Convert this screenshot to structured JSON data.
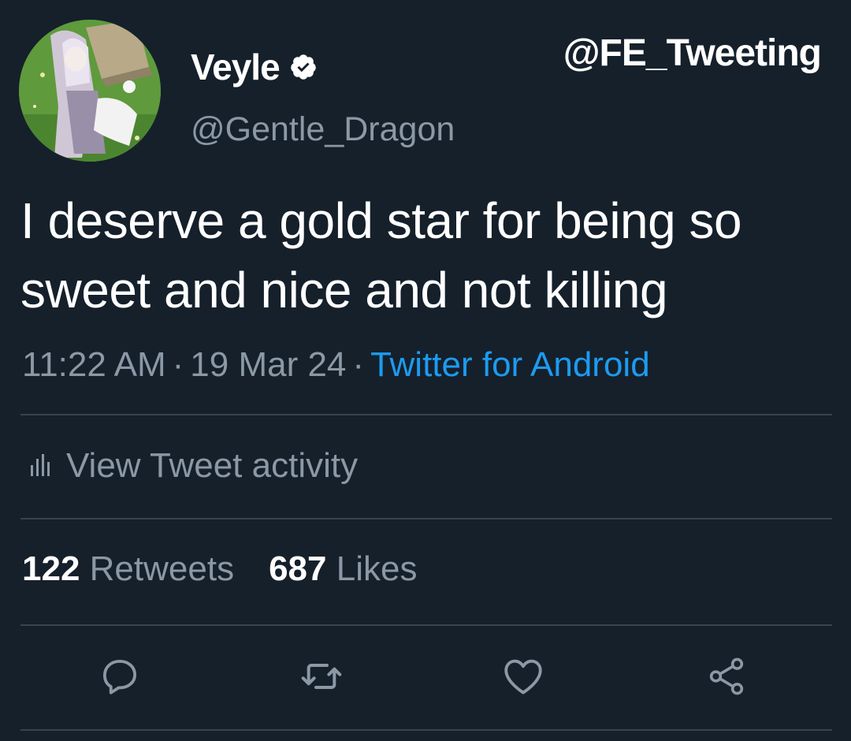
{
  "watermark": "@FE_Tweeting",
  "user": {
    "display_name": "Veyle",
    "handle": "@Gentle_Dragon"
  },
  "tweet": {
    "text": "I deserve a gold star for being so sweet and nice and not killing",
    "time": "11:22 AM",
    "date": "19 Mar 24",
    "separator": "·",
    "source": "Twitter for Android"
  },
  "activity": {
    "label": "View Tweet activity"
  },
  "stats": {
    "retweets_count": "122",
    "retweets_label": "Retweets",
    "likes_count": "687",
    "likes_label": "Likes"
  },
  "actions": [
    "reply-icon",
    "retweet-icon",
    "like-icon",
    "share-icon"
  ],
  "colors": {
    "background": "#15202b",
    "text": "#ffffff",
    "muted": "#8b98a5",
    "link": "#1d9bf0",
    "divider": "#38444d"
  }
}
